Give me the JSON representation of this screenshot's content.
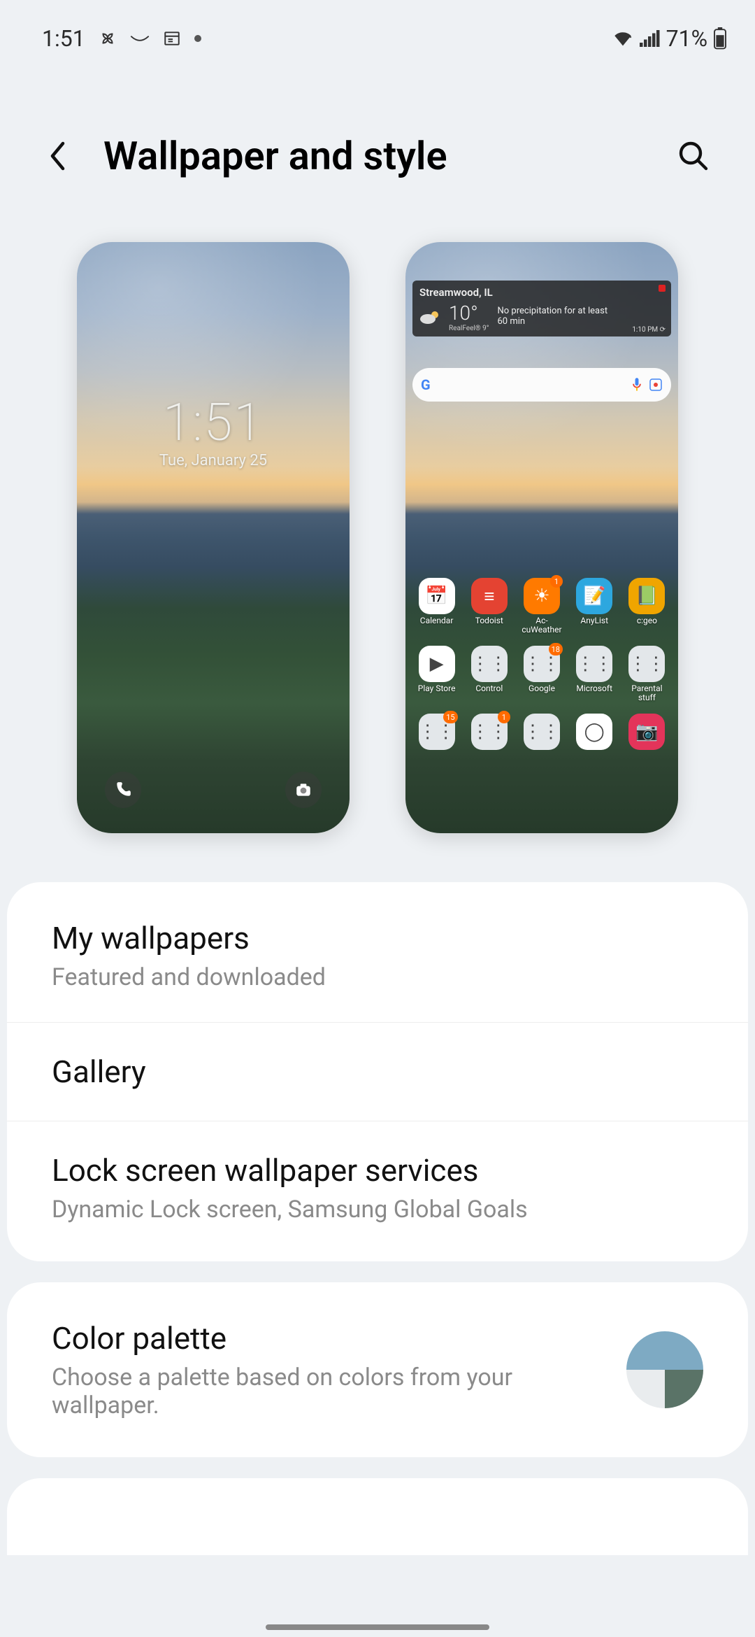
{
  "status": {
    "time": "1:51",
    "battery_text": "71%"
  },
  "header": {
    "title": "Wallpaper and style"
  },
  "lock_preview": {
    "time": "1:51",
    "date": "Tue, January 25"
  },
  "home_preview": {
    "weather": {
      "city": "Streamwood, IL",
      "temp": "10°",
      "realfeel_label": "RealFeel® 9°",
      "desc_line1": "No precipitation for at least",
      "desc_line2": "60 min",
      "updated": "1:10 PM"
    },
    "apps_row1": [
      {
        "label": "Calendar",
        "bg": "#ffffff",
        "glyph": "📅",
        "badge": ""
      },
      {
        "label": "Todoist",
        "bg": "#e44332",
        "glyph": "≡",
        "badge": ""
      },
      {
        "label": "Ac-cuWeather",
        "bg": "#ff7a00",
        "glyph": "☀",
        "badge": "1"
      },
      {
        "label": "AnyList",
        "bg": "#2da7df",
        "glyph": "📝",
        "badge": ""
      },
      {
        "label": "c:geo",
        "bg": "#f0a500",
        "glyph": "📗",
        "badge": ""
      }
    ],
    "apps_row2": [
      {
        "label": "Play Store",
        "bg": "#ffffff",
        "glyph": "▶",
        "badge": ""
      },
      {
        "label": "Control",
        "bg": "#e3e7ea",
        "glyph": "⋮⋮",
        "badge": ""
      },
      {
        "label": "Google",
        "bg": "#e3e7ea",
        "glyph": "⋮⋮",
        "badge": "18"
      },
      {
        "label": "Microsoft",
        "bg": "#e3e7ea",
        "glyph": "⋮⋮",
        "badge": ""
      },
      {
        "label": "Parental stuff",
        "bg": "#e3e7ea",
        "glyph": "⋮⋮",
        "badge": ""
      }
    ],
    "apps_row3": [
      {
        "label": "",
        "bg": "#e3e7ea",
        "glyph": "⋮⋮",
        "badge": "15"
      },
      {
        "label": "",
        "bg": "#e3e7ea",
        "glyph": "⋮⋮",
        "badge": "1"
      },
      {
        "label": "",
        "bg": "#e3e7ea",
        "glyph": "⋮⋮",
        "badge": ""
      },
      {
        "label": "",
        "bg": "#ffffff",
        "glyph": "◯",
        "badge": ""
      },
      {
        "label": "",
        "bg": "#e3345a",
        "glyph": "📷",
        "badge": ""
      }
    ]
  },
  "list": {
    "my_wallpapers": {
      "title": "My wallpapers",
      "sub": "Featured and downloaded"
    },
    "gallery": {
      "title": "Gallery"
    },
    "lock_services": {
      "title": "Lock screen wallpaper services",
      "sub": "Dynamic Lock screen, Samsung Global Goals"
    }
  },
  "palette": {
    "title": "Color palette",
    "sub": "Choose a palette based on colors from your wallpaper.",
    "colors": {
      "top": "#7eaac3",
      "bl": "#e9ecee",
      "br": "#5a7367"
    }
  }
}
